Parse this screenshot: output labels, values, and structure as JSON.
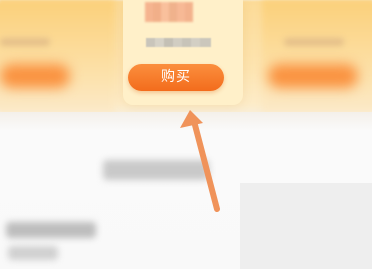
{
  "product_card": {
    "buy_label": "购买"
  },
  "colors": {
    "accent": "#f37a2b",
    "card_background": "#fff0c9",
    "arrow": "#f0935a"
  },
  "icons": {
    "pointer_arrow": "arrow-up-left-icon"
  }
}
